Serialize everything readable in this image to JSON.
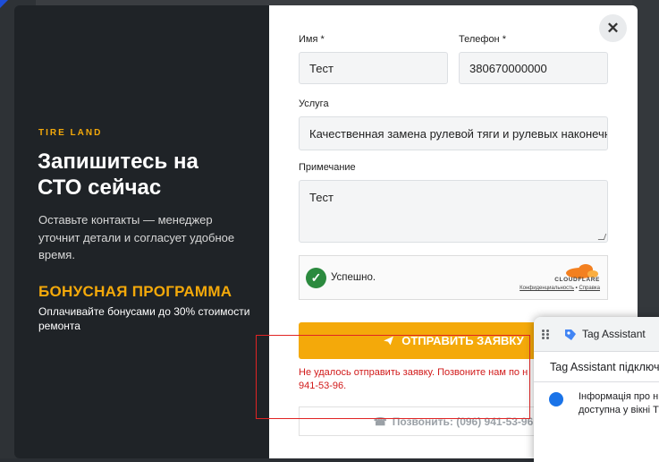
{
  "left_panel": {
    "brand": "TIRE LAND",
    "headline_line1": "Запишитесь на",
    "headline_line2": "СТО сейчас",
    "lead": "Оставьте контакты — менеджер уточнит детали и согласует удобное время.",
    "bonus_title": "БОНУСНАЯ ПРОГРАММА",
    "bonus_text": "Оплачивайте бонусами до 30% стоимости ремонта"
  },
  "form": {
    "name_label": "Имя *",
    "name_value": "Тест",
    "phone_label": "Телефон *",
    "phone_value": "380670000000",
    "service_label": "Услуга",
    "service_value": "Качественная замена рулевой тяги и рулевых наконечников",
    "note_label": "Примечание",
    "note_value": "Тест",
    "submit_label": "ОТПРАВИТЬ ЗАЯВКУ",
    "error_line1": "Не удалось отправить заявку. Позвоните нам по н",
    "error_line2": "941-53-96.",
    "call_label": "Позвонить: (096) 941-53-96"
  },
  "turnstile": {
    "status": "Успешно.",
    "brand": "CLOUDFLARE",
    "privacy": "Конфиденциальность",
    "separator": "•",
    "help": "Справка"
  },
  "close_icon": "close-icon",
  "tag_assistant": {
    "title": "Tag Assistant",
    "subtitle": "Tag Assistant підключ",
    "message_line1": "Інформація про н",
    "message_line2": "доступна у вікні Т"
  },
  "colors": {
    "accent": "#f4a90a",
    "dark_panel": "#1f2327",
    "error": "#d11a1a",
    "success": "#2b8a3e",
    "annotation": "#e02424"
  }
}
